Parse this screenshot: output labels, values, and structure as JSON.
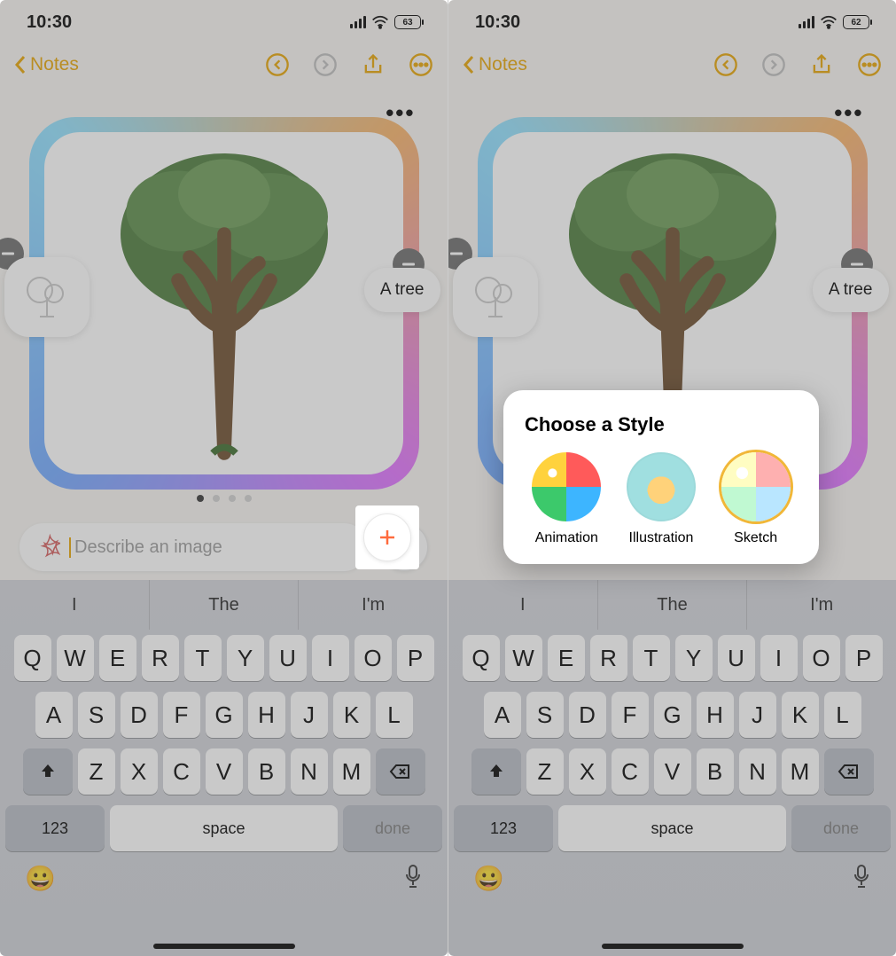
{
  "left": {
    "status": {
      "time": "10:30",
      "battery": "63"
    },
    "nav": {
      "back_label": "Notes"
    },
    "card": {
      "tag_label": "A tree",
      "more": "•••"
    },
    "prompt": {
      "placeholder": "Describe an image"
    },
    "suggestions": [
      "I",
      "The",
      "I'm"
    ],
    "keyboard": {
      "row1": [
        "Q",
        "W",
        "E",
        "R",
        "T",
        "Y",
        "U",
        "I",
        "O",
        "P"
      ],
      "row2": [
        "A",
        "S",
        "D",
        "F",
        "G",
        "H",
        "J",
        "K",
        "L"
      ],
      "row3": [
        "Z",
        "X",
        "C",
        "V",
        "B",
        "N",
        "M"
      ],
      "num": "123",
      "space": "space",
      "done": "done"
    }
  },
  "right": {
    "status": {
      "time": "10:30",
      "battery": "62"
    },
    "nav": {
      "back_label": "Notes"
    },
    "card": {
      "tag_label": "A tree",
      "more": "•••"
    },
    "popover": {
      "title": "Choose a Style",
      "options": [
        {
          "label": "Animation"
        },
        {
          "label": "Illustration"
        },
        {
          "label": "Sketch"
        }
      ],
      "selected_index": 2
    },
    "suggestions": [
      "I",
      "The",
      "I'm"
    ],
    "keyboard": {
      "row1": [
        "Q",
        "W",
        "E",
        "R",
        "T",
        "Y",
        "U",
        "I",
        "O",
        "P"
      ],
      "row2": [
        "A",
        "S",
        "D",
        "F",
        "G",
        "H",
        "J",
        "K",
        "L"
      ],
      "row3": [
        "Z",
        "X",
        "C",
        "V",
        "B",
        "N",
        "M"
      ],
      "num": "123",
      "space": "space",
      "done": "done"
    }
  }
}
